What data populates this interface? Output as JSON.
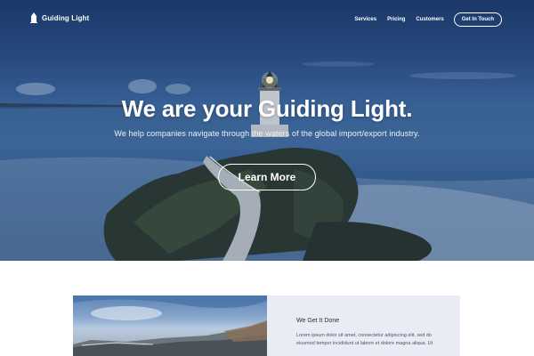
{
  "nav": {
    "brand": "Guiding Light",
    "brand_icon": "lighthouse-icon",
    "links": [
      "Services",
      "Pricing",
      "Customers"
    ],
    "cta": "Get In Touch"
  },
  "hero": {
    "title": "We are your Guiding Light.",
    "subtitle": "We help companies navigate through the waters of the global import/export industry.",
    "button": "Learn More"
  },
  "feature": {
    "title": "We Get It Done",
    "body": "Lorem ipsum dolor sit amet, consectetur adipiscing elit, sed do eiusmod tempor incididunt ut labore et dolore magna aliqua. Ut"
  },
  "colors": {
    "feature_card_bg": "#e9ecf4",
    "text_on_hero": "#ffffff"
  }
}
